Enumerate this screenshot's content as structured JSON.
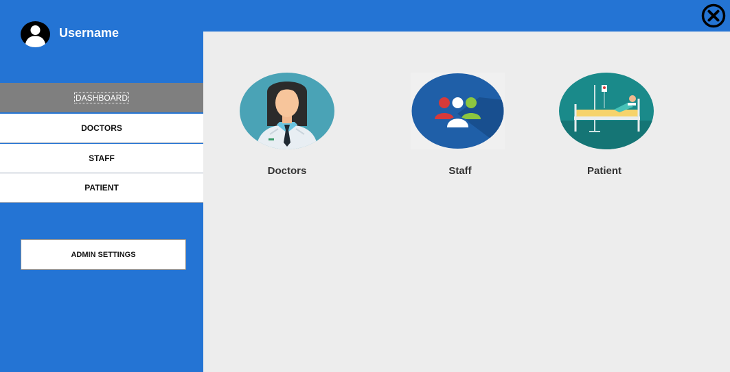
{
  "user": {
    "name": "Username",
    "icon": "user-avatar-icon"
  },
  "nav": {
    "items": [
      {
        "label": "DASHBOARD",
        "active": true
      },
      {
        "label": "DOCTORS",
        "active": false
      },
      {
        "label": "STAFF",
        "active": false
      },
      {
        "label": "PATIENT",
        "active": false
      }
    ],
    "admin_label": "ADMIN SETTINGS"
  },
  "dashboard": {
    "tiles": [
      {
        "label": "Doctors",
        "icon": "doctor-icon"
      },
      {
        "label": "Staff",
        "icon": "staff-group-icon"
      },
      {
        "label": "Patient",
        "icon": "patient-bed-icon"
      }
    ]
  },
  "window": {
    "close_icon": "close-icon"
  },
  "colors": {
    "brand_blue": "#2474d4",
    "content_bg": "#ededed",
    "active_nav": "#7f7f7f"
  }
}
